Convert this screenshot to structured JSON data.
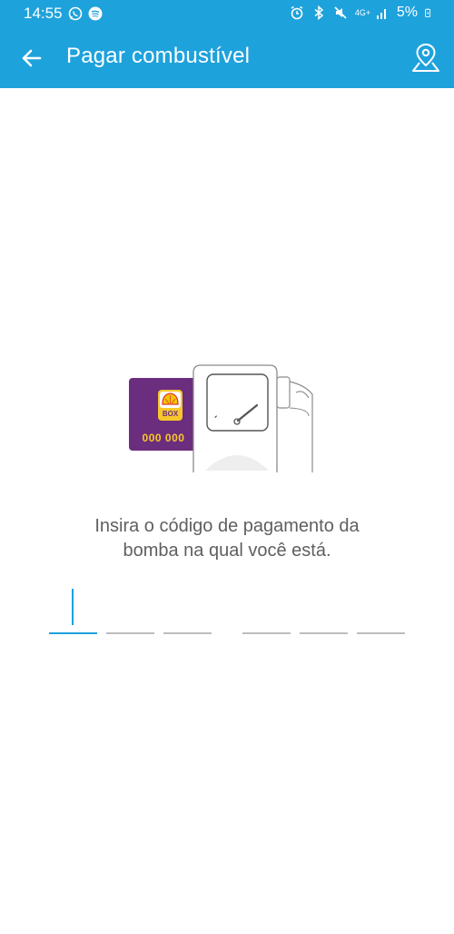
{
  "status_bar": {
    "time": "14:55",
    "battery": "5%",
    "network": "4G+",
    "left_icons": [
      "whatsapp-icon",
      "spotify-icon"
    ],
    "right_icons": [
      "alarm-icon",
      "bluetooth-icon",
      "mute-icon",
      "network-icon",
      "signal-icon",
      "battery-charging-icon"
    ]
  },
  "app_bar": {
    "title": "Pagar combustível",
    "back_icon": "arrow-back-icon",
    "action_icon": "map-pin-icon"
  },
  "illustration": {
    "card_label": "BOX",
    "card_number": "000 000",
    "card_color": "#6b2d7e",
    "brand_yellow": "#f7c72c"
  },
  "instruction": {
    "line1": "Insira o código de pagamento da",
    "line2": "bomba na qual você está."
  },
  "code_input": {
    "slots": [
      "",
      "",
      "",
      "",
      "",
      ""
    ],
    "active_slot": 0
  },
  "colors": {
    "primary": "#1ea2dc",
    "text": "#5f5f5f",
    "divider": "#bdbdbd"
  }
}
